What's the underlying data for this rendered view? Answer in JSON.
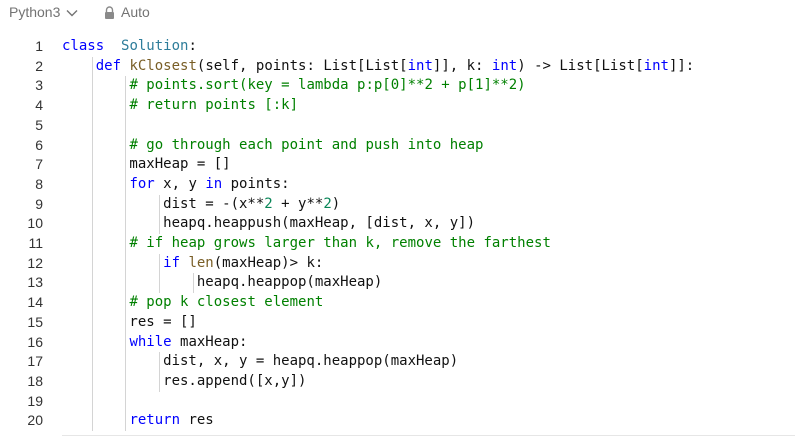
{
  "toolbar": {
    "language": "Python3",
    "mode": "Auto"
  },
  "icons": {
    "language_dropdown": "chevron-down-icon",
    "mode": "lock-icon"
  },
  "colors": {
    "keyword": "#0000ff",
    "class_name": "#2e7d9a",
    "function_name": "#795e26",
    "comment": "#008000",
    "number": "#098658",
    "text": "#111111",
    "line_number": "#333333"
  },
  "editor": {
    "lines": [
      {
        "num": "1",
        "tokens": [
          [
            "kw",
            "class"
          ],
          [
            "",
            "  "
          ],
          [
            "cls",
            "Solution"
          ],
          [
            "",
            ":"
          ]
        ]
      },
      {
        "num": "2",
        "tokens": [
          [
            "",
            "    "
          ],
          [
            "kw",
            "def"
          ],
          [
            "",
            " "
          ],
          [
            "fn",
            "kClosest"
          ],
          [
            "",
            "(self, points: List[List["
          ],
          [
            "kw",
            "int"
          ],
          [
            "",
            "]], k: "
          ],
          [
            "kw",
            "int"
          ],
          [
            "",
            ") -> List[List["
          ],
          [
            "kw",
            "int"
          ],
          [
            "",
            "]]:"
          ]
        ]
      },
      {
        "num": "3",
        "tokens": [
          [
            "",
            "        "
          ],
          [
            "cm",
            "# points.sort(key = lambda p:p[0]**2 + p[1]**2)"
          ]
        ]
      },
      {
        "num": "4",
        "tokens": [
          [
            "",
            "        "
          ],
          [
            "cm",
            "# return points [:k]"
          ]
        ]
      },
      {
        "num": "5",
        "tokens": []
      },
      {
        "num": "6",
        "tokens": [
          [
            "",
            "        "
          ],
          [
            "cm",
            "# go through each point and push into heap"
          ]
        ]
      },
      {
        "num": "7",
        "tokens": [
          [
            "",
            "        maxHeap = []"
          ]
        ]
      },
      {
        "num": "8",
        "tokens": [
          [
            "",
            "        "
          ],
          [
            "kw",
            "for"
          ],
          [
            "",
            " x, y "
          ],
          [
            "kw",
            "in"
          ],
          [
            "",
            " points:"
          ]
        ]
      },
      {
        "num": "9",
        "tokens": [
          [
            "",
            "            dist = -(x**"
          ],
          [
            "num",
            "2"
          ],
          [
            "",
            " + y**"
          ],
          [
            "num",
            "2"
          ],
          [
            "",
            ")"
          ]
        ]
      },
      {
        "num": "10",
        "tokens": [
          [
            "",
            "            heapq.heappush(maxHeap, [dist, x, y])"
          ]
        ]
      },
      {
        "num": "11",
        "tokens": [
          [
            "",
            "        "
          ],
          [
            "cm",
            "# if heap grows larger than k, remove the farthest"
          ]
        ]
      },
      {
        "num": "12",
        "tokens": [
          [
            "",
            "            "
          ],
          [
            "kw",
            "if"
          ],
          [
            "",
            " "
          ],
          [
            "bi",
            "len"
          ],
          [
            "",
            "(maxHeap)> k:"
          ]
        ]
      },
      {
        "num": "13",
        "tokens": [
          [
            "",
            "                heapq.heappop(maxHeap)"
          ]
        ]
      },
      {
        "num": "14",
        "tokens": [
          [
            "",
            "        "
          ],
          [
            "cm",
            "# pop k closest element"
          ]
        ]
      },
      {
        "num": "15",
        "tokens": [
          [
            "",
            "        res = []"
          ]
        ]
      },
      {
        "num": "16",
        "tokens": [
          [
            "",
            "        "
          ],
          [
            "kw",
            "while"
          ],
          [
            "",
            " maxHeap:"
          ]
        ]
      },
      {
        "num": "17",
        "tokens": [
          [
            "",
            "            dist, x, y = heapq.heappop(maxHeap)"
          ]
        ]
      },
      {
        "num": "18",
        "tokens": [
          [
            "",
            "            res.append([x,y])"
          ]
        ]
      },
      {
        "num": "19",
        "tokens": []
      },
      {
        "num": "20",
        "tokens": [
          [
            "",
            "        "
          ],
          [
            "kw",
            "return"
          ],
          [
            "",
            " res"
          ]
        ]
      }
    ]
  }
}
